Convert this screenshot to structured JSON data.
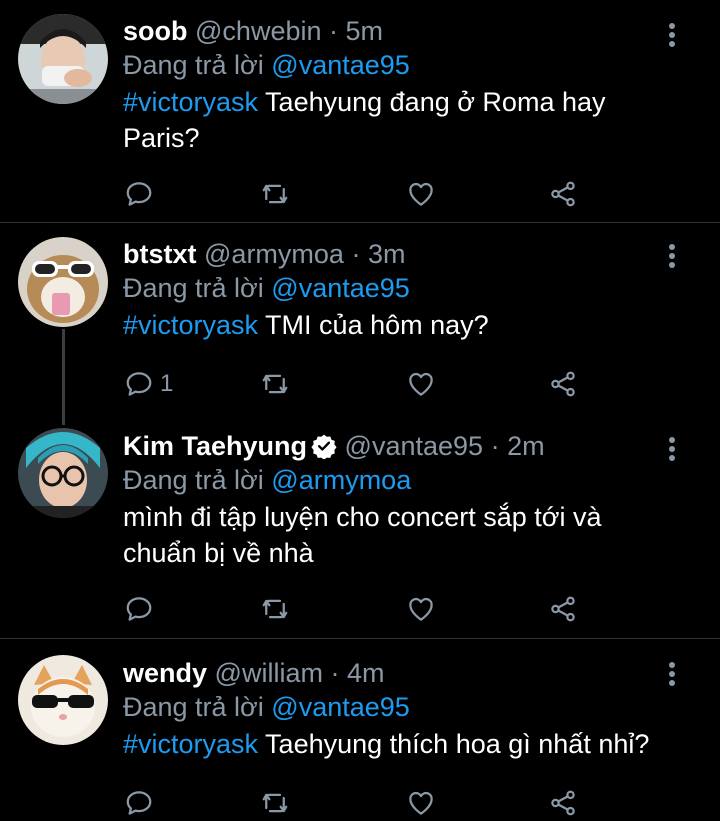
{
  "tweets": [
    {
      "name": "soob",
      "handle": "@chwebin",
      "dot": "·",
      "time": "5m",
      "replying_prefix": "Đang trả lời",
      "replying_to": "@vantae95",
      "hashtag": "#victoryask",
      "text": " Taehyung đang ở Roma hay Paris?",
      "reply_count": ""
    },
    {
      "name": "btstxt",
      "handle": "@armymoa",
      "dot": "·",
      "time": "3m",
      "replying_prefix": "Đang trả lời",
      "replying_to": "@vantae95",
      "hashtag": "#victoryask",
      "text": " TMI của hôm nay?",
      "reply_count": "1"
    },
    {
      "name": "Kim Taehyung",
      "handle": "@vantae95",
      "dot": "·",
      "time": "2m",
      "replying_prefix": "Đang trả lời",
      "replying_to": "@armymoa",
      "hashtag": "",
      "text": "mình đi tập luyện cho concert sắp tới và chuẩn bị về nhà",
      "reply_count": ""
    },
    {
      "name": "wendy",
      "handle": "@william",
      "dot": "·",
      "time": "4m",
      "replying_prefix": "Đang trả lời",
      "replying_to": "@vantae95",
      "hashtag": "#victoryask",
      "text": " Taehyung thích hoa gì nhất nhỉ?",
      "reply_count": ""
    }
  ],
  "colors": {
    "background": "#000000",
    "text": "#ffffff",
    "secondary": "#8b98a5",
    "accent": "#1d9bf0",
    "divider": "#2f3336"
  },
  "icons": [
    "reply-icon",
    "retweet-icon",
    "like-icon",
    "share-icon",
    "more-icon",
    "verified-badge-icon"
  ]
}
